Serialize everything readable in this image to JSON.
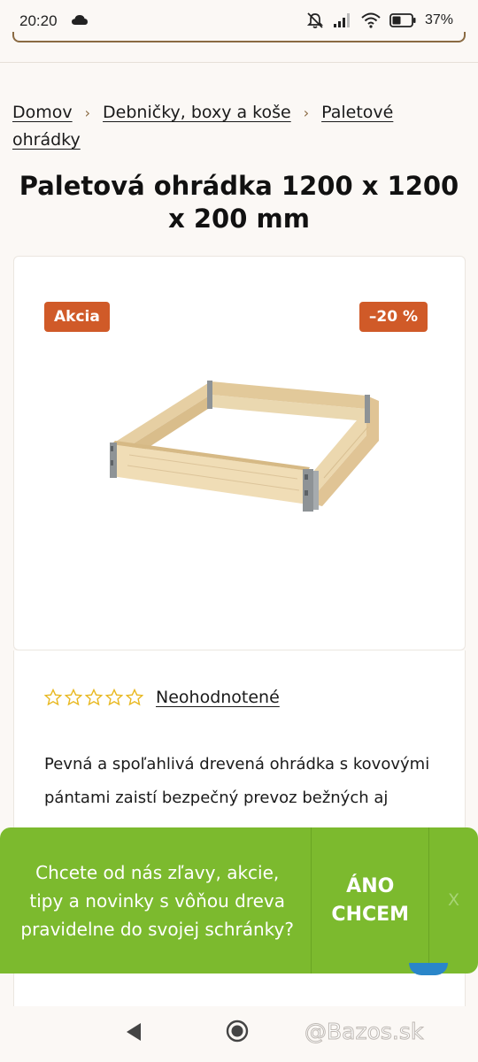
{
  "status_bar": {
    "time": "20:20",
    "battery_percent": "37%",
    "icons": [
      "cloud-icon",
      "mute-icon",
      "signal-icon",
      "wifi-icon",
      "battery-icon"
    ]
  },
  "breadcrumb": {
    "items": [
      "Domov",
      "Debničky, boxy a koše",
      "Paletové ohrádky"
    ],
    "separator": "›"
  },
  "product": {
    "title": "Paletová ohrádka 1200 x 1200 x 200 mm",
    "sale_badge": "Akcia",
    "discount_badge": "–20 %",
    "rating_text": "Neohodnotené",
    "stars_filled": 0,
    "stars_total": 5,
    "description": "Pevná a spoľahlivá drevená ohrádka s kovovými pántami zaistí bezpečný prevoz bežných aj"
  },
  "newsletter": {
    "text": "Chcete od nás zľavy, akcie, tipy a novinky s vôňou dreva pravidelne do svojej schránky?",
    "cta_label": "ÁNO CHCEM",
    "close_label": "X"
  },
  "watermark": "@Bazos.sk",
  "colors": {
    "accent_brown": "#8a6a42",
    "badge_orange": "#d05a28",
    "newsletter_green": "#7cba2e",
    "star_yellow": "#e8b820"
  }
}
